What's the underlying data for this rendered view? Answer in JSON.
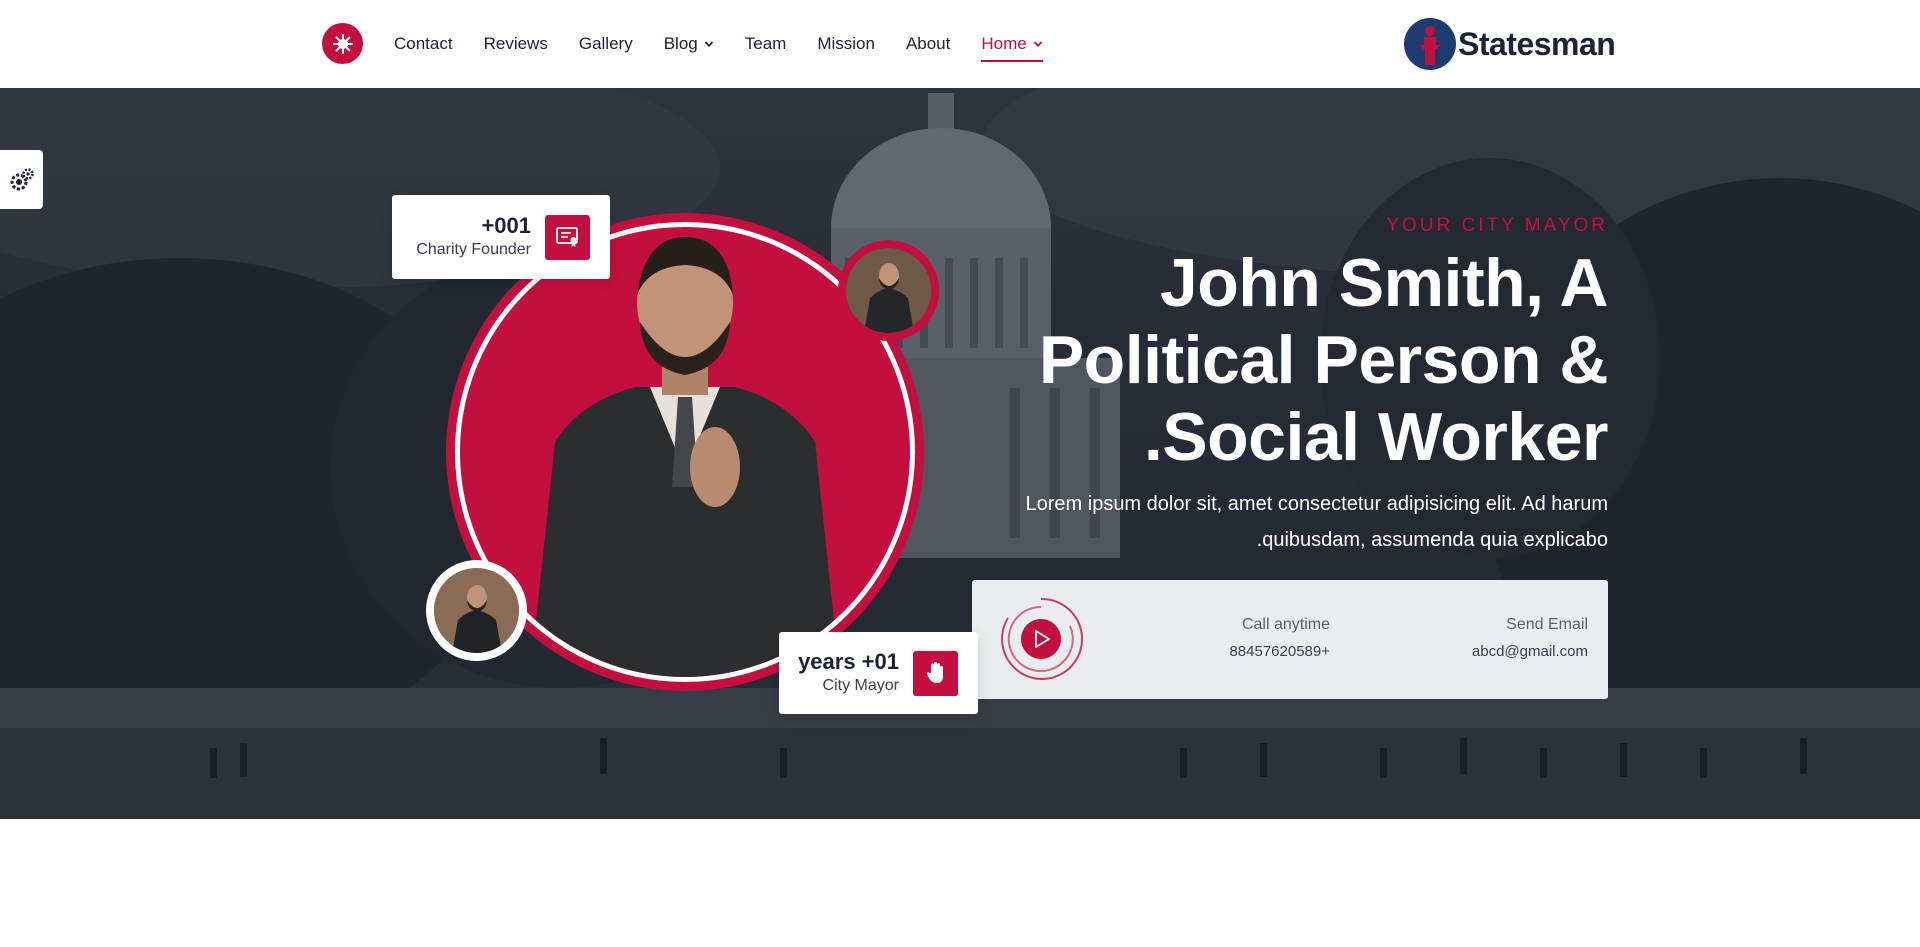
{
  "nav": {
    "items": [
      {
        "label": "Contact",
        "has_dropdown": false,
        "active": false
      },
      {
        "label": "Reviews",
        "has_dropdown": false,
        "active": false
      },
      {
        "label": "Gallery",
        "has_dropdown": false,
        "active": false
      },
      {
        "label": "Blog",
        "has_dropdown": true,
        "active": false
      },
      {
        "label": "Team",
        "has_dropdown": false,
        "active": false
      },
      {
        "label": "Mission",
        "has_dropdown": false,
        "active": false
      },
      {
        "label": "About",
        "has_dropdown": false,
        "active": false
      },
      {
        "label": "Home",
        "has_dropdown": true,
        "active": true
      }
    ]
  },
  "brand": {
    "name": "Statesman",
    "icon": "podium-person-logo"
  },
  "hero": {
    "eyebrow": "YOUR CITY MAYOR",
    "headline_lines": [
      "John Smith, A",
      "Political Person &",
      ".Social Worker"
    ],
    "lead_lines": [
      "Lorem ipsum dolor sit, amet consectetur adipisicing elit. Ad harum",
      ".quibusdam, assumenda quia explicabo"
    ],
    "stats": {
      "founder": {
        "number": "+001",
        "label": "Charity Founder",
        "icon": "certificate-icon"
      },
      "mayor": {
        "number": "years +01",
        "label": "City Mayor",
        "icon": "hand-icon"
      }
    },
    "contact": {
      "call_label": "Call anytime",
      "call_value": "88457620589+",
      "mail_label": "Send Email",
      "mail_value": "abcd@gmail.com"
    }
  },
  "colors": {
    "accent": "#c30f3e",
    "text": "#1c2237",
    "panel": "#e9edf0",
    "brand_blue": "#1d3b6e"
  }
}
